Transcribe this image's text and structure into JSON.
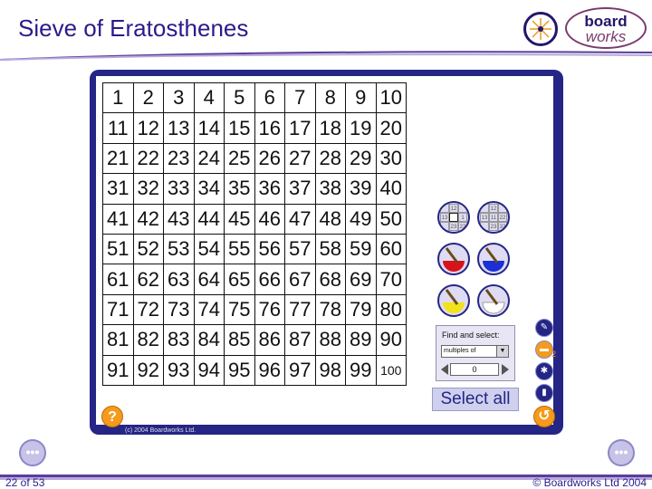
{
  "slide": {
    "title": "Sieve of Eratosthenes",
    "page_number": "22 of 53",
    "footer_copyright": "© Boardworks Ltd 2004",
    "brand_top": "board",
    "brand_bottom": "works",
    "screen_copyright": "(c) 2004 Boardworks Ltd."
  },
  "grid": {
    "rows": [
      [
        "1",
        "2",
        "3",
        "4",
        "5",
        "6",
        "7",
        "8",
        "9",
        "10"
      ],
      [
        "11",
        "12",
        "13",
        "14",
        "15",
        "16",
        "17",
        "18",
        "19",
        "20"
      ],
      [
        "21",
        "22",
        "23",
        "24",
        "25",
        "26",
        "27",
        "28",
        "29",
        "30"
      ],
      [
        "31",
        "32",
        "33",
        "34",
        "35",
        "36",
        "37",
        "38",
        "39",
        "40"
      ],
      [
        "41",
        "42",
        "43",
        "44",
        "45",
        "46",
        "47",
        "48",
        "49",
        "50"
      ],
      [
        "51",
        "52",
        "53",
        "54",
        "55",
        "56",
        "57",
        "58",
        "59",
        "60"
      ],
      [
        "61",
        "62",
        "63",
        "64",
        "65",
        "66",
        "67",
        "68",
        "69",
        "70"
      ],
      [
        "71",
        "72",
        "73",
        "74",
        "75",
        "76",
        "77",
        "78",
        "79",
        "80"
      ],
      [
        "81",
        "82",
        "83",
        "84",
        "85",
        "86",
        "87",
        "88",
        "89",
        "90"
      ],
      [
        "91",
        "92",
        "93",
        "94",
        "95",
        "96",
        "97",
        "98",
        "99",
        "100"
      ]
    ]
  },
  "tools": {
    "mini_blank": [
      "12",
      "13",
      "1",
      "23",
      "22",
      "32",
      "33"
    ],
    "mini_numbered": [
      "12",
      "13",
      "11",
      "22",
      "23",
      "32",
      "33"
    ],
    "paint_colors": {
      "red": "#d8121b",
      "blue": "#1a2fd6",
      "yellow": "#f2e21a",
      "white": "#ffffff"
    }
  },
  "find_panel": {
    "label": "Find and select:",
    "mode": "multiples of",
    "value": "0"
  },
  "select_all_label": "Select all",
  "side_buttons": {
    "number_badge": "2",
    "help": "?"
  },
  "colors": {
    "title": "#2b1a8c",
    "frame": "#252585",
    "accent_orange": "#f59a1b"
  }
}
